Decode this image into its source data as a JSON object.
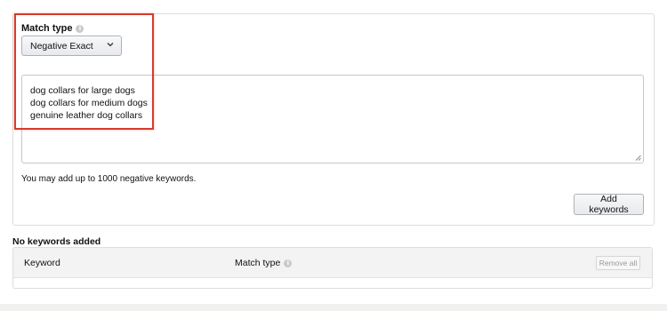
{
  "match_type": {
    "label": "Match type",
    "selected": "Negative Exact"
  },
  "keywords_textarea": {
    "lines": [
      "dog collars for large dogs",
      "dog collars for medium dogs",
      "genuine leather dog collars"
    ]
  },
  "helper_text": "You may add up to 1000 negative keywords.",
  "add_button": {
    "label": "Add keywords"
  },
  "added_section": {
    "title": "No keywords added",
    "columns": {
      "keyword": "Keyword",
      "match_type": "Match type"
    },
    "remove_all_label": "Remove all"
  },
  "colors": {
    "highlight": "#d63b2b",
    "border": "#dddddd",
    "table_header_bg": "#f3f3f3"
  },
  "icons": {
    "info": "info-icon",
    "dropdown": "chevron-down-icon",
    "resize": "resize-grip-icon"
  }
}
